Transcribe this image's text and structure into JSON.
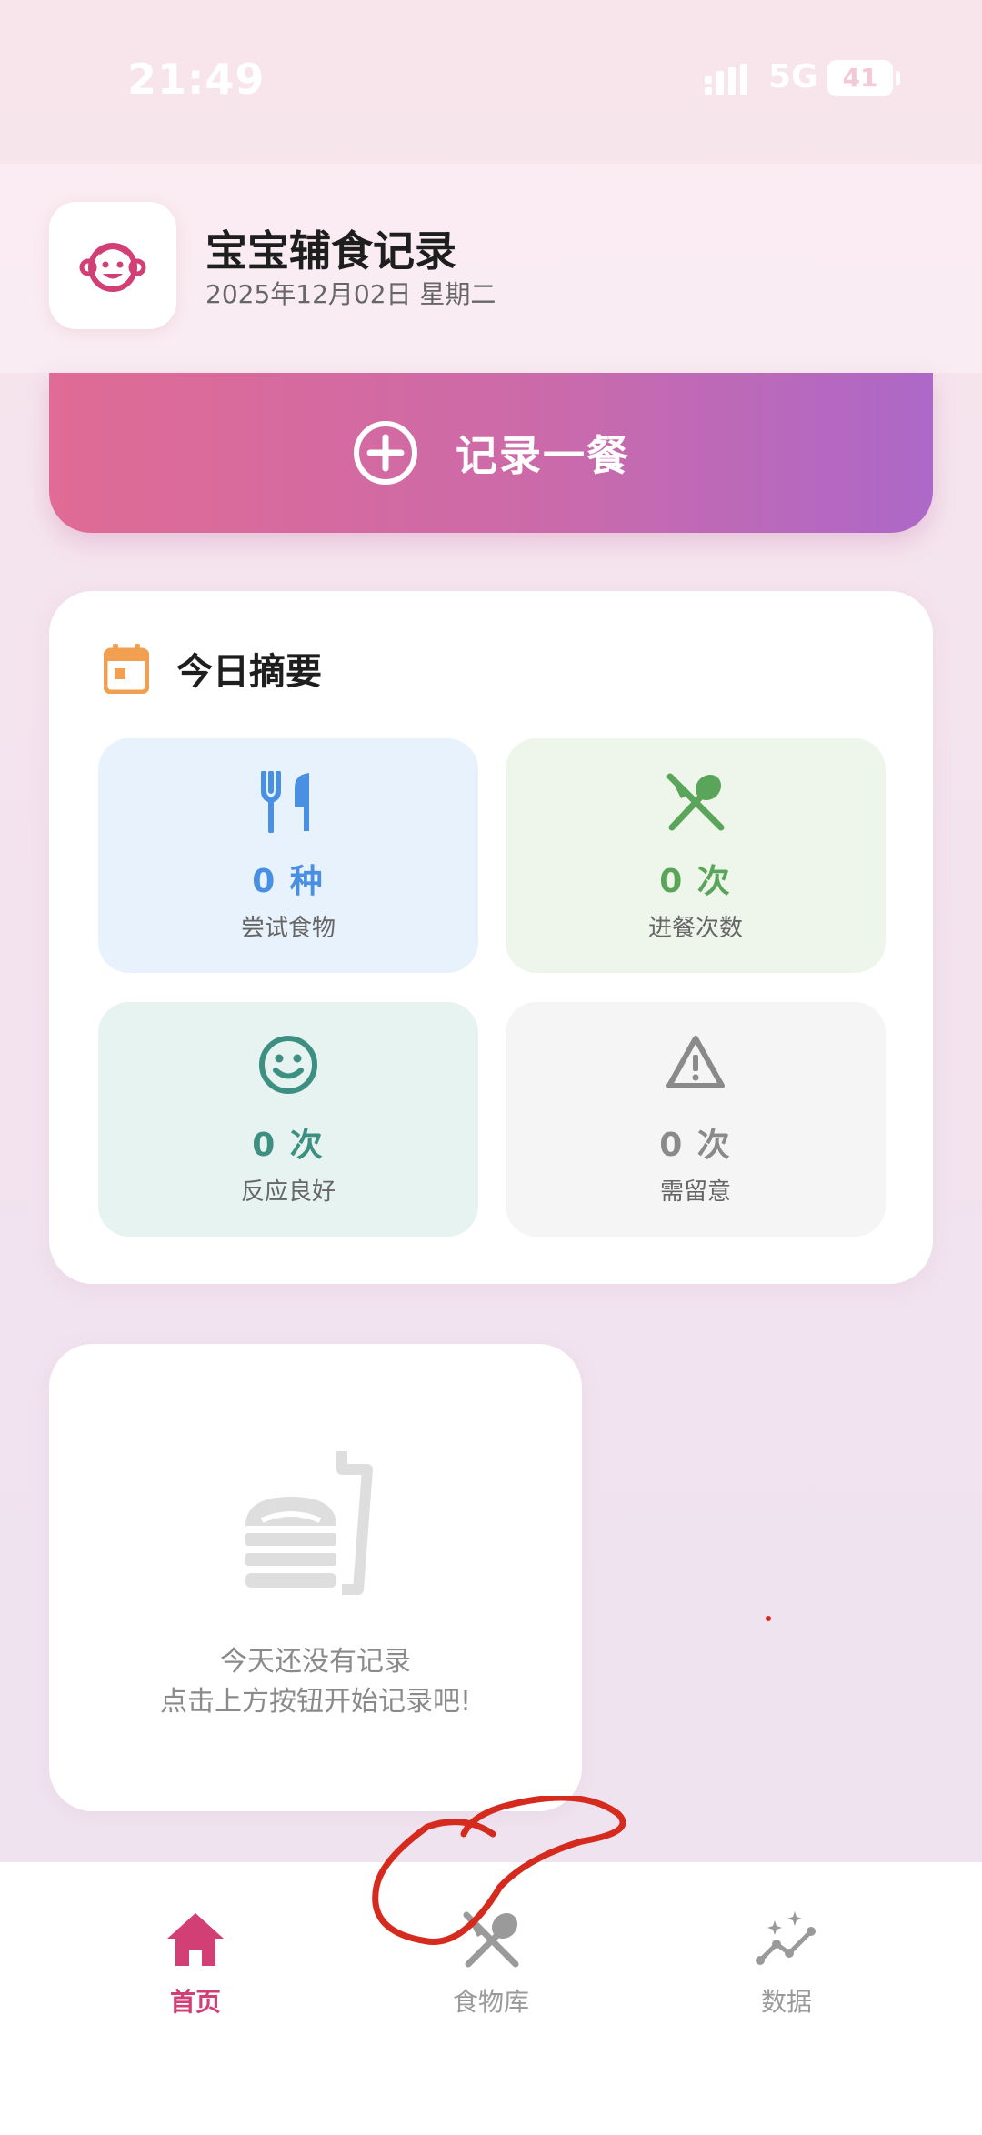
{
  "status_bar": {
    "time": "21:49",
    "network": "5G",
    "battery": "41"
  },
  "header": {
    "title": "宝宝辅食记录",
    "date": "2025年12月02日 星期二",
    "logo_icon": "baby-face-icon"
  },
  "record_button": {
    "label": "记录一餐",
    "icon": "plus-circle-icon"
  },
  "summary": {
    "title": "今日摘要",
    "icon": "calendar-icon",
    "tiles": [
      {
        "value": "0 种",
        "label": "尝试食物",
        "icon": "fork-knife-icon",
        "color": "#4a90e2"
      },
      {
        "value": "0 次",
        "label": "进餐次数",
        "icon": "utensils-crossed-icon",
        "color": "#5aa55a"
      },
      {
        "value": "0 次",
        "label": "反应良好",
        "icon": "smile-icon",
        "color": "#3d8f82"
      },
      {
        "value": "0 次",
        "label": "需留意",
        "icon": "warning-icon",
        "color": "#8a8a8a"
      }
    ]
  },
  "empty_state": {
    "line1": "今天还没有记录",
    "line2": "点击上方按钮开始记录吧!",
    "icon": "fastfood-icon"
  },
  "bottom_nav": [
    {
      "label": "首页",
      "icon": "home-icon",
      "active": true
    },
    {
      "label": "食物库",
      "icon": "utensils-crossed-icon",
      "active": false
    },
    {
      "label": "数据",
      "icon": "trend-sparkle-icon",
      "active": false
    }
  ],
  "colors": {
    "accent": "#d23f74",
    "gradient_start": "#e06b94",
    "gradient_end": "#ad68c8",
    "annotation": "#d52b1e"
  }
}
